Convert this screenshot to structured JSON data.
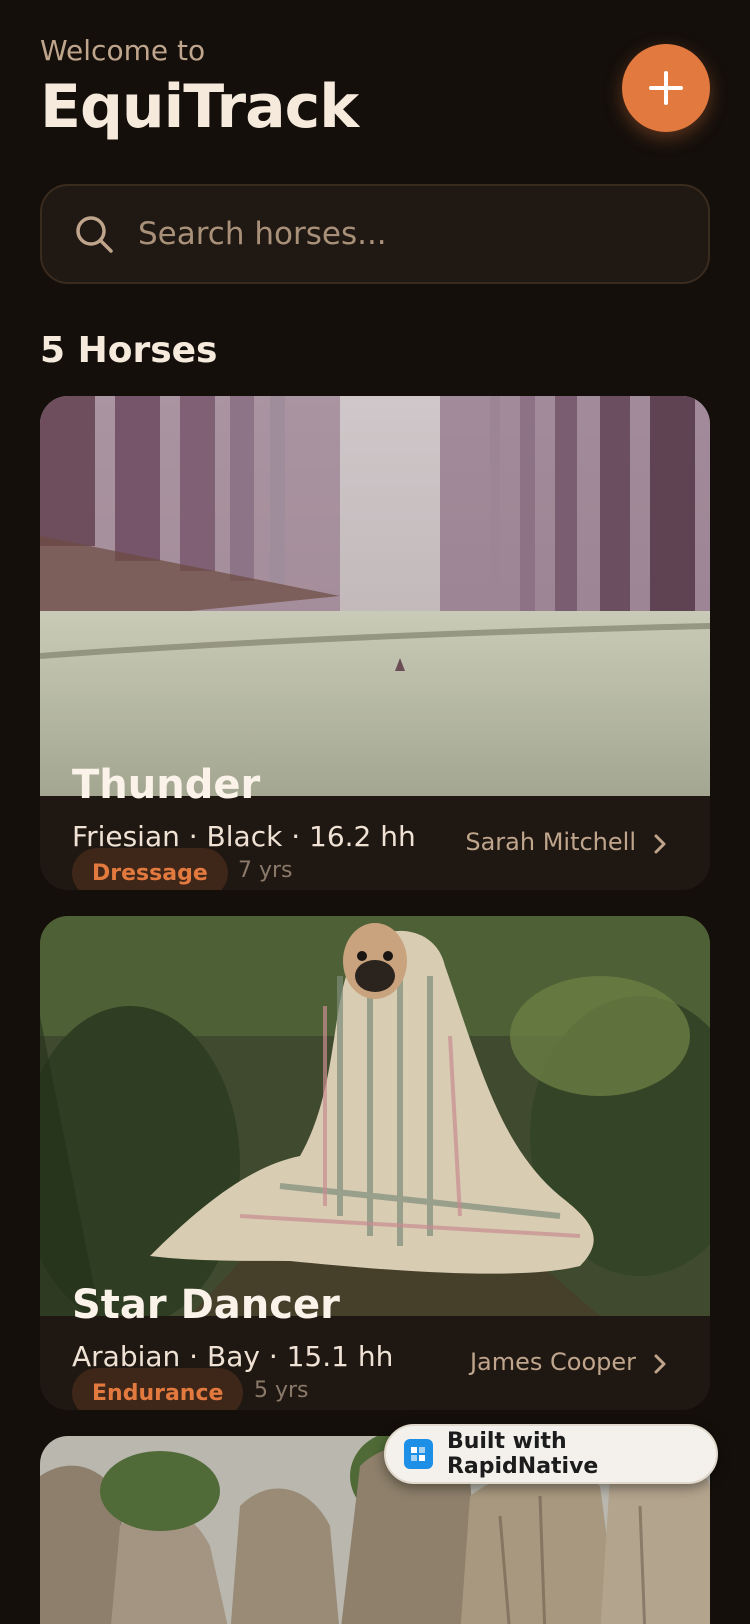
{
  "header": {
    "welcome": "Welcome to",
    "title": "EquiTrack"
  },
  "search": {
    "placeholder": "Search horses..."
  },
  "list": {
    "count_label": "5 Horses"
  },
  "horses": [
    {
      "name": "Thunder",
      "breed_line": "Friesian · Black · 16.2 hh",
      "discipline": "Dressage",
      "age": "7 yrs",
      "owner": "Sarah Mitchell"
    },
    {
      "name": "Star Dancer",
      "breed_line": "Arabian · Bay · 15.1 hh",
      "discipline": "Endurance",
      "age": "5 yrs",
      "owner": "James Cooper"
    }
  ],
  "badge": {
    "label": "Built with RapidNative"
  },
  "colors": {
    "background": "#140f0b",
    "accent": "#e2793e",
    "card": "#1f1712"
  }
}
